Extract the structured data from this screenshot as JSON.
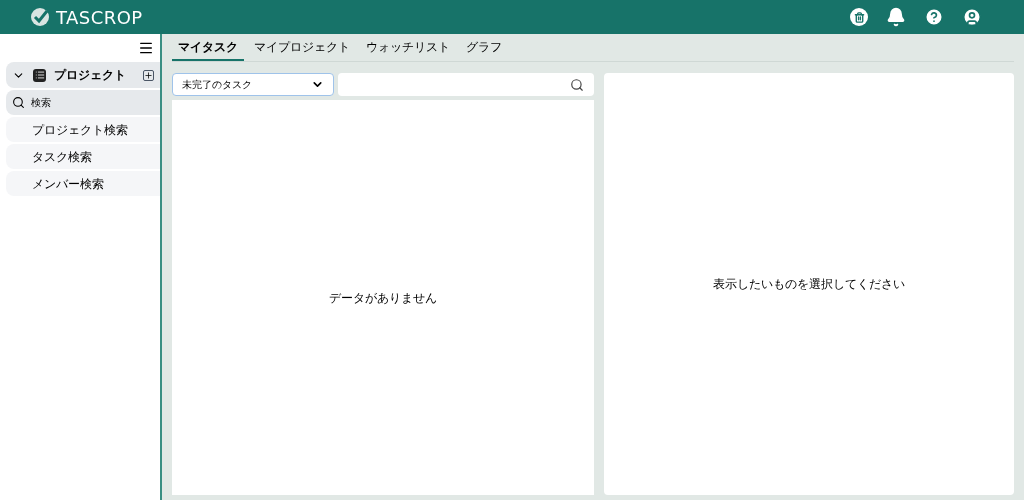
{
  "app": {
    "logo": "TASCROP"
  },
  "sidebar": {
    "project_group": {
      "label": "プロジェクト",
      "expanded": true
    },
    "search_group": {
      "label": "検索",
      "items": [
        {
          "label": "プロジェクト検索"
        },
        {
          "label": "タスク検索"
        },
        {
          "label": "メンバー検索"
        }
      ]
    }
  },
  "tabs": [
    {
      "label": "マイタスク",
      "selected": true
    },
    {
      "label": "マイプロジェクト",
      "selected": false
    },
    {
      "label": "ウォッチリスト",
      "selected": false
    },
    {
      "label": "グラフ",
      "selected": false
    }
  ],
  "filter": {
    "value": "未完了のタスク"
  },
  "task_list": {
    "empty_message": "データがありません"
  },
  "detail": {
    "empty_message": "表示したいものを選択してください"
  }
}
